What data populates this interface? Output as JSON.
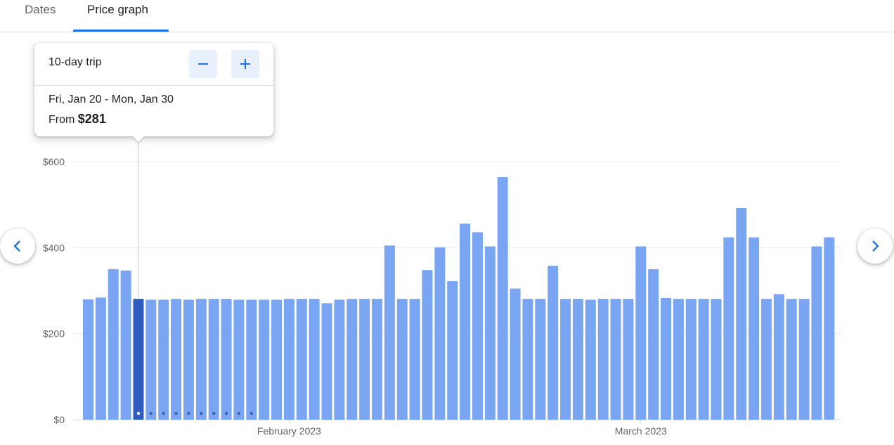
{
  "tabs": [
    {
      "label": "Dates",
      "active": false
    },
    {
      "label": "Price graph",
      "active": true
    }
  ],
  "popup": {
    "trip_length": "10-day trip",
    "decrease_icon": "minus-icon",
    "increase_icon": "plus-icon",
    "date_range": "Fri, Jan 20 - Mon, Jan 30",
    "from_prefix": "From",
    "price": "$281"
  },
  "nav": {
    "prev_icon": "chevron-left-icon",
    "next_icon": "chevron-right-icon"
  },
  "colors": {
    "bar": "#7aa5f2",
    "bar_selected": "#2f5bbf",
    "accent": "#1a73e8",
    "trip_dot": "#3c5fb0",
    "grid": "#e8eaed"
  },
  "chart_data": {
    "type": "bar",
    "ylim": [
      0,
      600
    ],
    "yticks": [
      "$0",
      "$200",
      "$400",
      "$600"
    ],
    "ytick_values": [
      0,
      200,
      400,
      600
    ],
    "month_labels": [
      "February 2023",
      "March 2023"
    ],
    "month_label_index": [
      16,
      44
    ],
    "selected_index": 4,
    "trip_dot_count": 10,
    "grid": true,
    "values": [
      280,
      284,
      350,
      347,
      281,
      279,
      279,
      281,
      279,
      281,
      281,
      281,
      279,
      279,
      279,
      279,
      281,
      281,
      281,
      271,
      279,
      281,
      281,
      281,
      405,
      281,
      281,
      348,
      401,
      322,
      456,
      436,
      403,
      564,
      305,
      281,
      281,
      358,
      281,
      281,
      279,
      281,
      281,
      281,
      403,
      350,
      283,
      281,
      281,
      281,
      281,
      424,
      492,
      424,
      281,
      292,
      281,
      281,
      403,
      424
    ]
  }
}
